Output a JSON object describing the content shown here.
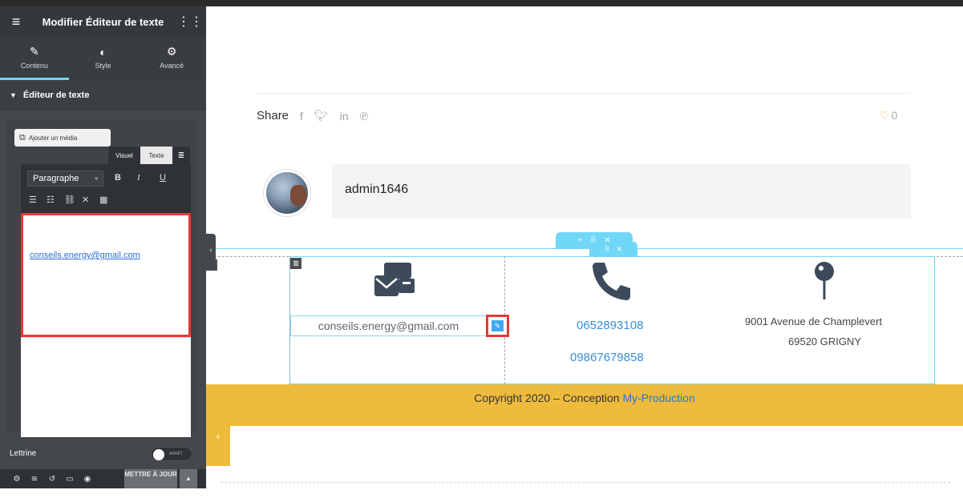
{
  "sidebar": {
    "title": "Modifier Éditeur de texte",
    "tabs": [
      {
        "label": "Contenu",
        "icon": "pencil-icon"
      },
      {
        "label": "Style",
        "icon": "half-circle-icon"
      },
      {
        "label": "Avancé",
        "icon": "gear-icon"
      }
    ],
    "section_title": "Éditeur de texte",
    "media_button": "Ajouter un média",
    "mode_tabs": [
      "Visuel",
      "Texte"
    ],
    "paragraph_select": "Paragraphe",
    "editor_content": "conseils.energy@gmail.com",
    "lettrine_label": "Lettrine",
    "toggle_label": "ARRÊT",
    "update_button": "METTRE À JOUR"
  },
  "post": {
    "share_label": "Share",
    "likes_count": "0",
    "author_name": "admin1646"
  },
  "contact": {
    "email_value": "conseils.energy@gmail.com",
    "phones": [
      "0652893108",
      "09867679858"
    ],
    "address_line1": "9001 Avenue de Champlevert",
    "address_line2": "69520 GRIGNY"
  },
  "footer": {
    "copyright_prefix": "Copyright 2020 – Conception ",
    "brand": "My-Production"
  },
  "colors": {
    "accent": "#71d7f7",
    "highlight": "#e53935",
    "footer": "#efbb3c",
    "link": "#3a8fd8"
  }
}
